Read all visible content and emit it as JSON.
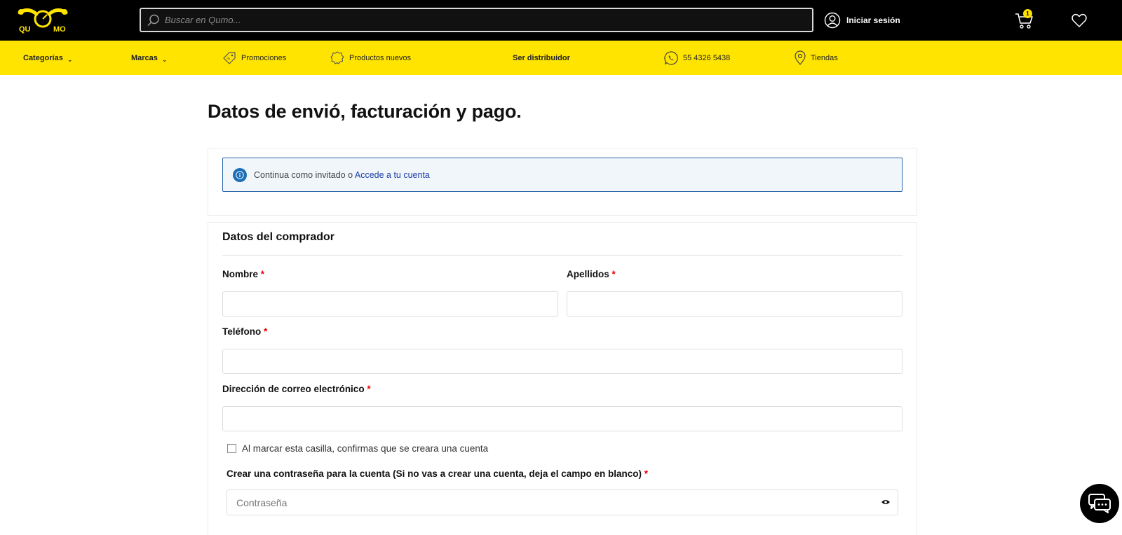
{
  "header": {
    "logo_text": "QUMO",
    "search_placeholder": "Buscar en Qumo...",
    "login_label": "Iniciar sesión",
    "cart_count": "1"
  },
  "nav": {
    "categorias": "Categorías",
    "marcas": "Marcas",
    "promociones": "Promociones",
    "productos_nuevos": "Productos nuevos",
    "ser_distribuidor": "Ser distribuidor",
    "telefono": "55 4326 5438",
    "tiendas": "Tiendas",
    "caret": "⌄"
  },
  "main": {
    "title": "Datos de envió, facturación y pago.",
    "alert_text": "Continua como invitado o",
    "alert_link": "Accede a tu cuenta"
  },
  "buyer": {
    "section_title": "Datos del comprador",
    "nombre_label": "Nombre",
    "apellidos_label": "Apellidos",
    "telefono_label": "Teléfono",
    "email_label": "Dirección de correo electrónico",
    "required_mark": "*",
    "create_account_text": "Al marcar esta casilla, confirmas que se creara una cuenta",
    "password_label": "Crear una contraseña para la cuenta (Si no vas a crear una cuenta, deja el campo en blanco)",
    "password_placeholder": "Contraseña"
  },
  "colors": {
    "brand_yellow": "#ffe400",
    "header_black": "#000000",
    "link_blue": "#1c3fa6",
    "required_red": "#e00000"
  }
}
